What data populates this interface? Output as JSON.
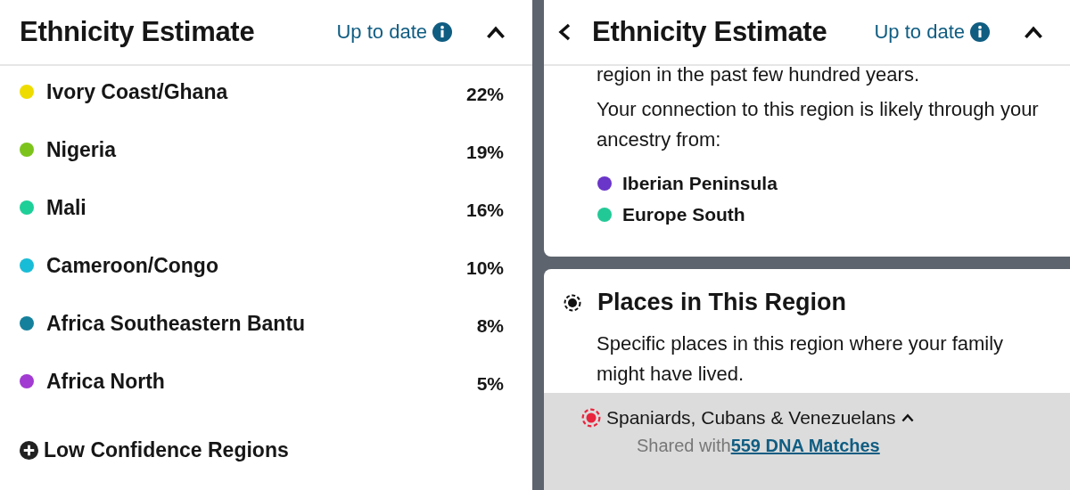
{
  "left": {
    "header": {
      "title": "Ethnicity Estimate",
      "status": "Up to date"
    },
    "regions": [
      {
        "name": "Ivory Coast/Ghana",
        "percent": "22%",
        "color": "#eedc00"
      },
      {
        "name": "Nigeria",
        "percent": "19%",
        "color": "#7cc41c"
      },
      {
        "name": "Mali",
        "percent": "16%",
        "color": "#1ecf98"
      },
      {
        "name": "Cameroon/Congo",
        "percent": "10%",
        "color": "#19bcd6"
      },
      {
        "name": "Africa Southeastern Bantu",
        "percent": "8%",
        "color": "#15809c"
      },
      {
        "name": "Africa North",
        "percent": "5%",
        "color": "#a13bd1"
      }
    ],
    "low_confidence": {
      "label": "Low Confidence Regions",
      "expanded": false
    }
  },
  "right": {
    "header": {
      "title": "Ethnicity Estimate",
      "status": "Up to date"
    },
    "details": {
      "paragraphs": [
        "region in the past few hundred years.",
        "Your connection to this region is likely through your ancestry from:"
      ],
      "regions": [
        {
          "name": "Iberian Peninsula",
          "color": "#6a35c9"
        },
        {
          "name": "Europe South",
          "color": "#22c996"
        }
      ]
    },
    "places": {
      "title": "Places in This Region",
      "description": "Specific places in this region where your family might have lived.",
      "place": {
        "name": "Spaniards, Cubans & Venezuelans",
        "expanded": true,
        "shared_label": "Shared with",
        "matches_link": "559 DNA Matches"
      }
    }
  }
}
